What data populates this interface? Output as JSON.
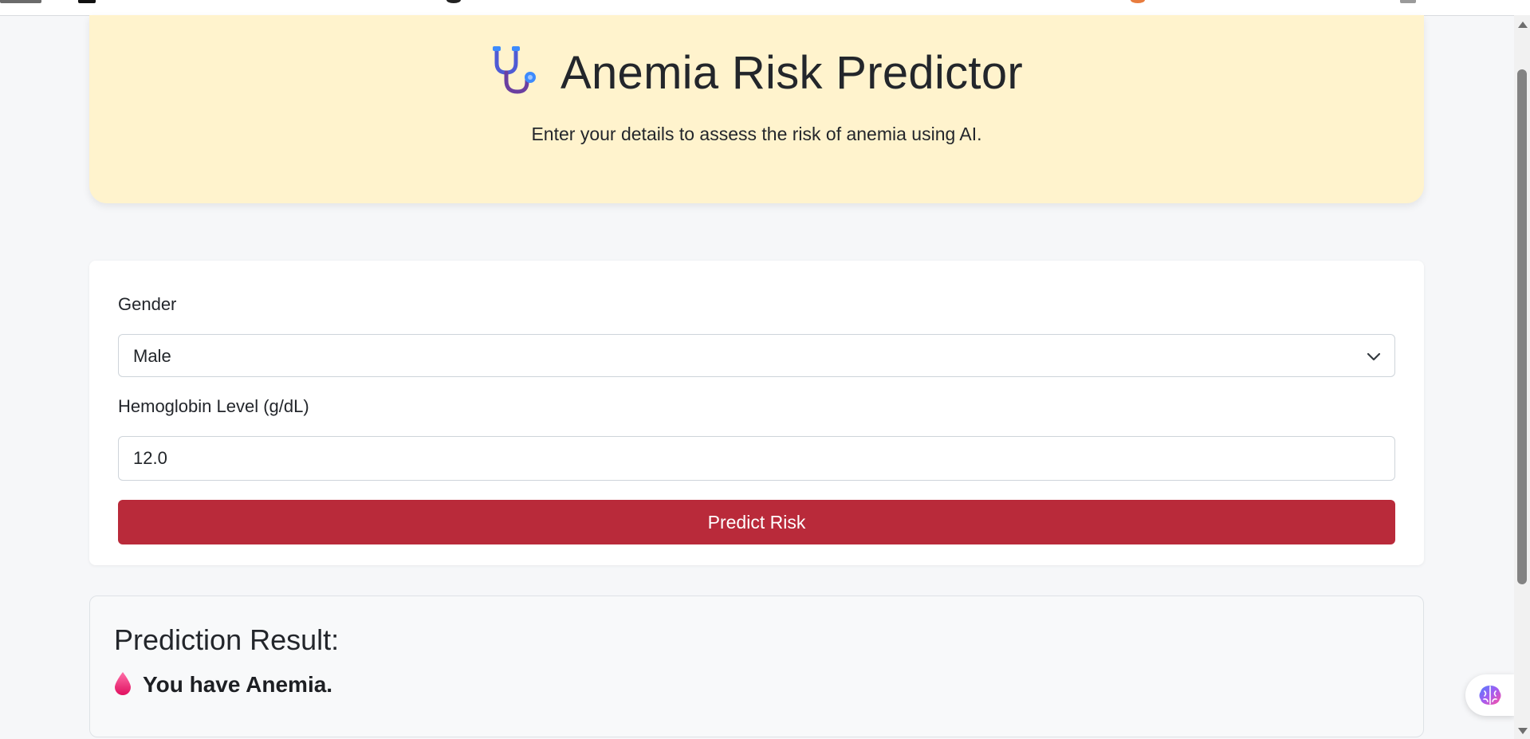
{
  "header": {
    "title": "Anemia Risk Predictor",
    "subtitle": "Enter your details to assess the risk of anemia using AI.",
    "icon": "stethoscope-icon",
    "background_color": "#fff3cd"
  },
  "form": {
    "gender_label": "Gender",
    "gender_value": "Male",
    "hemoglobin_label": "Hemoglobin Level (g/dL)",
    "hemoglobin_value": "12.0",
    "submit_label": "Predict Risk",
    "submit_color": "#b92a3a"
  },
  "result": {
    "heading": "Prediction Result:",
    "message": "You have Anemia.",
    "icon": "blood-drop-icon"
  },
  "widget": {
    "icon": "brain-icon"
  }
}
